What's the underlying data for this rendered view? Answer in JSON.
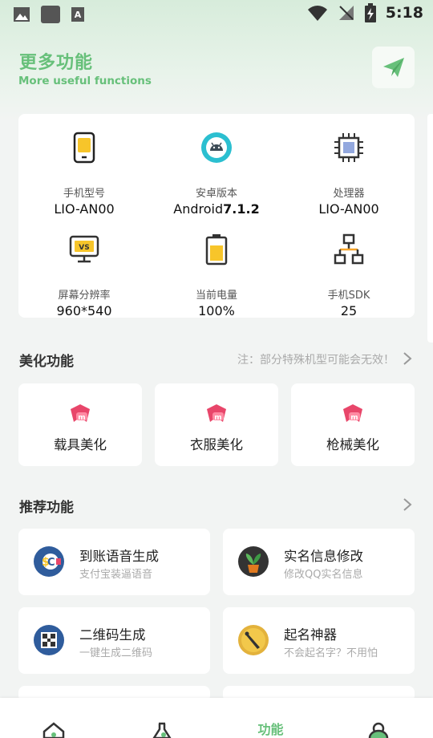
{
  "status_bar": {
    "time": "5:18"
  },
  "header": {
    "title": "更多功能",
    "subtitle": "More useful functions"
  },
  "device_info": [
    {
      "label": "手机型号",
      "value": "LIO-AN00"
    },
    {
      "label": "安卓版本",
      "value_prefix": "Android",
      "value_strong": "7.1.2"
    },
    {
      "label": "处理器",
      "value": "LIO-AN00"
    },
    {
      "label": "屏幕分辨率",
      "value": "960*540"
    },
    {
      "label": "当前电量",
      "value": "100%"
    },
    {
      "label": "手机SDK",
      "value": "25"
    }
  ],
  "beautify": {
    "title": "美化功能",
    "note": "注：部分特殊机型可能会无效！",
    "items": [
      {
        "label": "载具美化"
      },
      {
        "label": "衣服美化"
      },
      {
        "label": "枪械美化"
      }
    ]
  },
  "recommend": {
    "title": "推荐功能",
    "items": [
      {
        "title": "到账语音生成",
        "subtitle": "支付宝装逼语音"
      },
      {
        "title": "实名信息修改",
        "subtitle": "修改QQ实名信息"
      },
      {
        "title": "二维码生成",
        "subtitle": "一键生成二维码"
      },
      {
        "title": "起名神器",
        "subtitle": "不会起名字？不用怕"
      }
    ]
  },
  "bottom_nav": {
    "active_label": "功能"
  },
  "colors": {
    "accent": "#67c07a",
    "beauty_icon": "#e8466a",
    "text_muted": "#aaaaaa"
  }
}
